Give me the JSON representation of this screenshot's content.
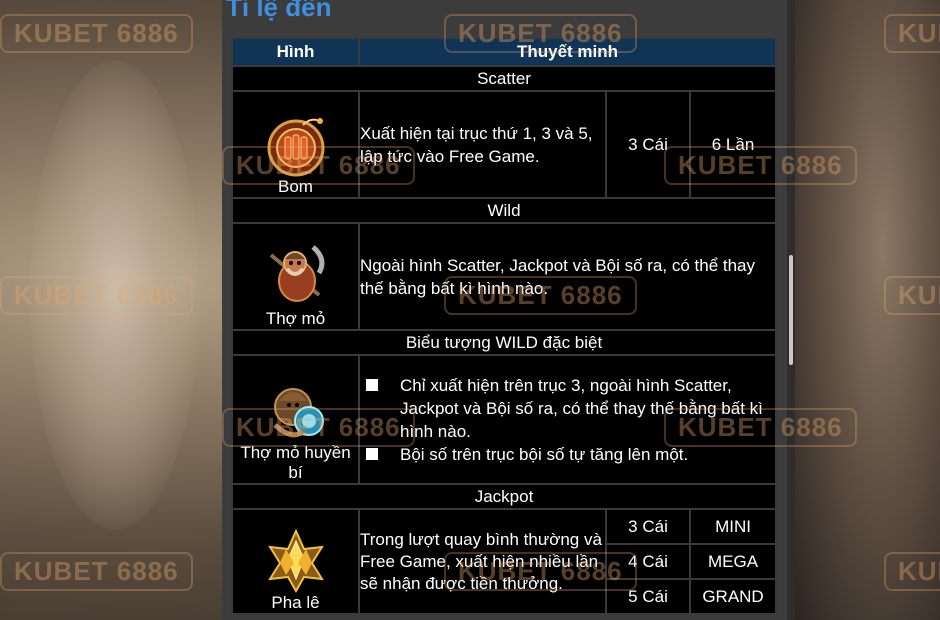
{
  "section_title": "Tỉ lệ đền",
  "table": {
    "headers": [
      "Hình",
      "Thuyết minh"
    ],
    "scatter": {
      "section": "Scatter",
      "name": "Bom",
      "description": "Xuất hiện tại trục thứ 1, 3 và 5, lập tức vào Free Game.",
      "count": "3 Cái",
      "reward": "6 Lần"
    },
    "wild": {
      "section": "Wild",
      "name": "Thợ mỏ",
      "description": "Ngoài hình Scatter, Jackpot và Bội số ra, có thể thay thế bằng bất kì hình nào."
    },
    "special_wild": {
      "section": "Biểu tượng WILD đặc biệt",
      "name": "Thợ mỏ huyền bí",
      "items": [
        "Chỉ xuất hiện trên trục 3, ngoài hình Scatter, Jackpot và Bội số ra, có thể thay thế bằng bất kì hình nào.",
        "Bội số trên trục bội số tự tăng lên một."
      ]
    },
    "jackpot": {
      "section": "Jackpot",
      "name": "Pha lê",
      "description": "Trong lượt quay bình thường và Free Game, xuất hiện nhiều lần sẽ nhận được tiền thưởng.",
      "rows": [
        {
          "count": "3 Cái",
          "tier": "MINI"
        },
        {
          "count": "4 Cái",
          "tier": "MEGA"
        },
        {
          "count": "5 Cái",
          "tier": "GRAND"
        }
      ]
    }
  },
  "watermark": "KUBET 6886",
  "colors": {
    "title": "#3d8fe0",
    "header_bg": "#0f3456",
    "table_bg": "#000000",
    "watermark": "#e8a86a"
  }
}
